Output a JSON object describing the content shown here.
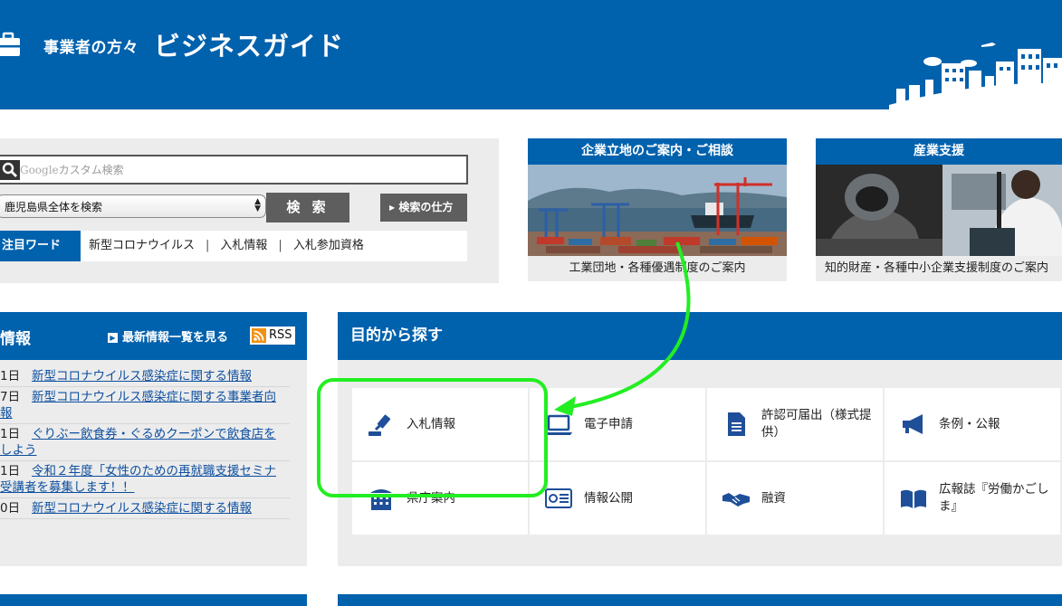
{
  "header": {
    "subtitle": "事業者の方々",
    "title": "ビジネスガイド"
  },
  "search": {
    "google_word": "Google",
    "placeholder": "カスタム検索",
    "scope": "鹿児島県全体を検索",
    "search_button": "検 索",
    "howto_button": "検索の仕方",
    "keyword_label": "注目ワード",
    "keywords": [
      "新型コロナウイルス",
      "入札情報",
      "入札参加資格"
    ]
  },
  "cards": [
    {
      "title": "企業立地のご案内・ご相談",
      "caption": "工業団地・各種優遇制度のご案内"
    },
    {
      "title": "産業支援",
      "caption": "知的財産・各種中小企業支援制度のご案内"
    }
  ],
  "news": {
    "title": "情報",
    "more": "最新情報一覧を見る",
    "rss": "RSS",
    "items": [
      {
        "date": "1日",
        "line1": "新型コロナウイルス感染症に関する情報",
        "line2": ""
      },
      {
        "date": "7日",
        "line1": "新型コロナウイルス感染症に関する事業者向",
        "line2": "報"
      },
      {
        "date": "1日",
        "line1": "ぐりぶー飲食券・ぐるめクーポンで飲食店を",
        "line2": "しよう"
      },
      {
        "date": "1日",
        "line1": "令和２年度「女性のための再就職支援セミナ",
        "line2": "受講者を募集します！！"
      },
      {
        "date": "0日",
        "line1": "新型コロナウイルス感染症に関する情報",
        "line2": ""
      }
    ]
  },
  "purpose": {
    "title": "目的から探す",
    "tiles": [
      {
        "label": "入札情報",
        "icon": "gavel-icon"
      },
      {
        "label": "電子申請",
        "icon": "laptop-icon"
      },
      {
        "label": "許認可届出（様式提供）",
        "icon": "document-icon"
      },
      {
        "label": "条例・公報",
        "icon": "megaphone-icon"
      },
      {
        "label": "県庁案内",
        "icon": "building-icon"
      },
      {
        "label": "情報公開",
        "icon": "id-card-icon"
      },
      {
        "label": "融資",
        "icon": "handshake-icon"
      },
      {
        "label": "広報誌『労働かごしま』",
        "icon": "open-book-icon"
      }
    ]
  },
  "colors": {
    "primary": "#0061ad",
    "panel": "#ececec",
    "button": "#5e5e5e",
    "link": "#0d4f9f",
    "annotation": "#22ee22",
    "rss": "#f29111"
  }
}
